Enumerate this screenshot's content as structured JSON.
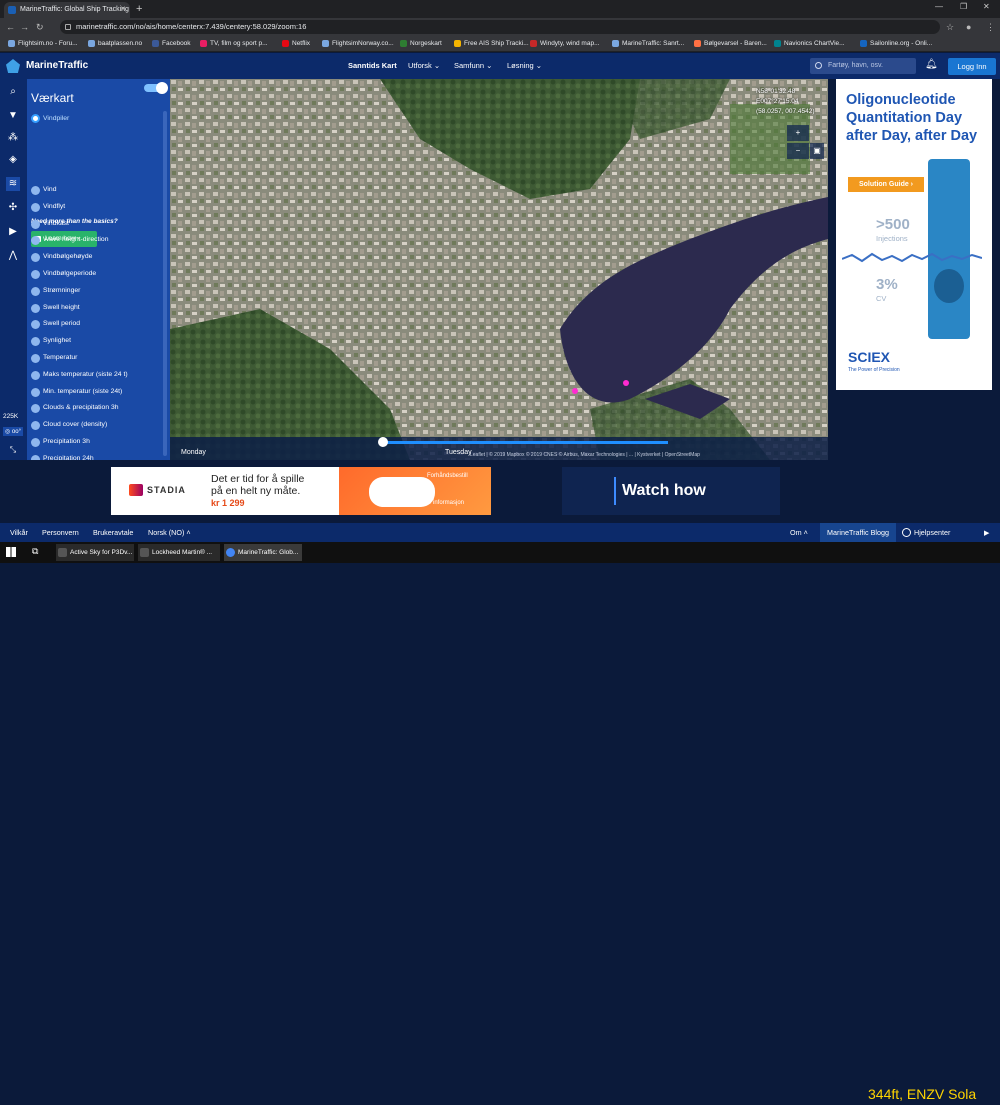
{
  "browser": {
    "tab_title": "MarineTraffic: Global Ship Tracking",
    "new_tab": "+",
    "url": "marinetraffic.com/no/ais/home/centerx:7.439/centery:58.029/zoom:16",
    "bookmarks": [
      "Flightsim.no - Foru...",
      "baatplassen.no",
      "Facebook",
      "TV, film og sport p...",
      "Netflix",
      "FlightsimNorway.co...",
      "Norgeskart",
      "Free AIS Ship Tracki...",
      "Windyty, wind map...",
      "MarineTraffic: Sanrt...",
      "Bølgevarsel - Baren...",
      "Navionics ChartVie...",
      "Sailonline.org - Onli..."
    ]
  },
  "header": {
    "logo": "MarineTraffic",
    "nav": [
      "Sanntids Kart",
      "Utforsk ⌄",
      "Samfunn ⌄",
      "Løsning ⌄"
    ],
    "search_placeholder": "Fartøy, havn, osv.",
    "login": "Logg Inn"
  },
  "rail": {
    "icons": [
      "search-icon",
      "filter-icon",
      "network-icon",
      "layers-icon",
      "weather-icon",
      "cross-icon",
      "play-icon",
      "measure-icon"
    ],
    "count": "225K",
    "badge": "◎ oo°"
  },
  "panel": {
    "title": "Værkart",
    "selected": "Vindpiler",
    "upsell": "Need more than the basics?",
    "learn_how": "Learn how ›",
    "items": [
      "Vind",
      "Vindflyt",
      "Vindkast",
      "Wave height-direction",
      "Vindbølgehøyde",
      "Vindbølgeperiode",
      "Strømninger",
      "Swell height",
      "Swell period",
      "Synlighet",
      "Temperatur",
      "Maks temperatur (siste 24 t)",
      "Min. temperatur (siste 24t)",
      "Clouds & precipitation 3h",
      "Cloud cover (density)",
      "Precipitation 3h",
      "Precipitation 24h"
    ]
  },
  "map": {
    "coords": [
      "N58°01'32.48",
      "E007°27'15.04",
      "(58.0257, 007.4542)"
    ],
    "timeline_days": [
      "Monday",
      "Tuesday"
    ],
    "attribution": "Leaflet | © 2019 Mapbox © 2019 CNES © Airbus, Maxar Technologies | ...  | Kystverket | OpenStreetMap"
  },
  "side_ad": {
    "headline": "Oligonucleotide Quantitation Day after Day, after Day",
    "button": "Solution Guide ›",
    "stat1": ">500",
    "stat1_sub": "Injections",
    "stat2": "3%",
    "stat2_sub": "CV",
    "brand": "SCIEX",
    "tagline": "The Power of Precision"
  },
  "bottom_ad": {
    "brand": "STADIA",
    "text_line1": "Det er tid for å spille",
    "text_line2": "på en helt ny måte.",
    "price": "kr 1 299",
    "cta": "Forhåndsbestill",
    "info": "Mer informasjon"
  },
  "watch_ad": {
    "text": "Watch how"
  },
  "footer": {
    "links": [
      "Vilkår",
      "Personvern",
      "Brukeravtale",
      "Norsk (NO) ˄"
    ],
    "om": "Om ˄",
    "blog": "MarineTraffic Blogg",
    "help": "Hjelpsenter"
  },
  "taskbar": {
    "apps": [
      "Active Sky for P3Dv...",
      "Lockheed Martin® ...",
      "MarineTraffic: Glob..."
    ]
  },
  "overlay": "344ft, ENZV Sola"
}
